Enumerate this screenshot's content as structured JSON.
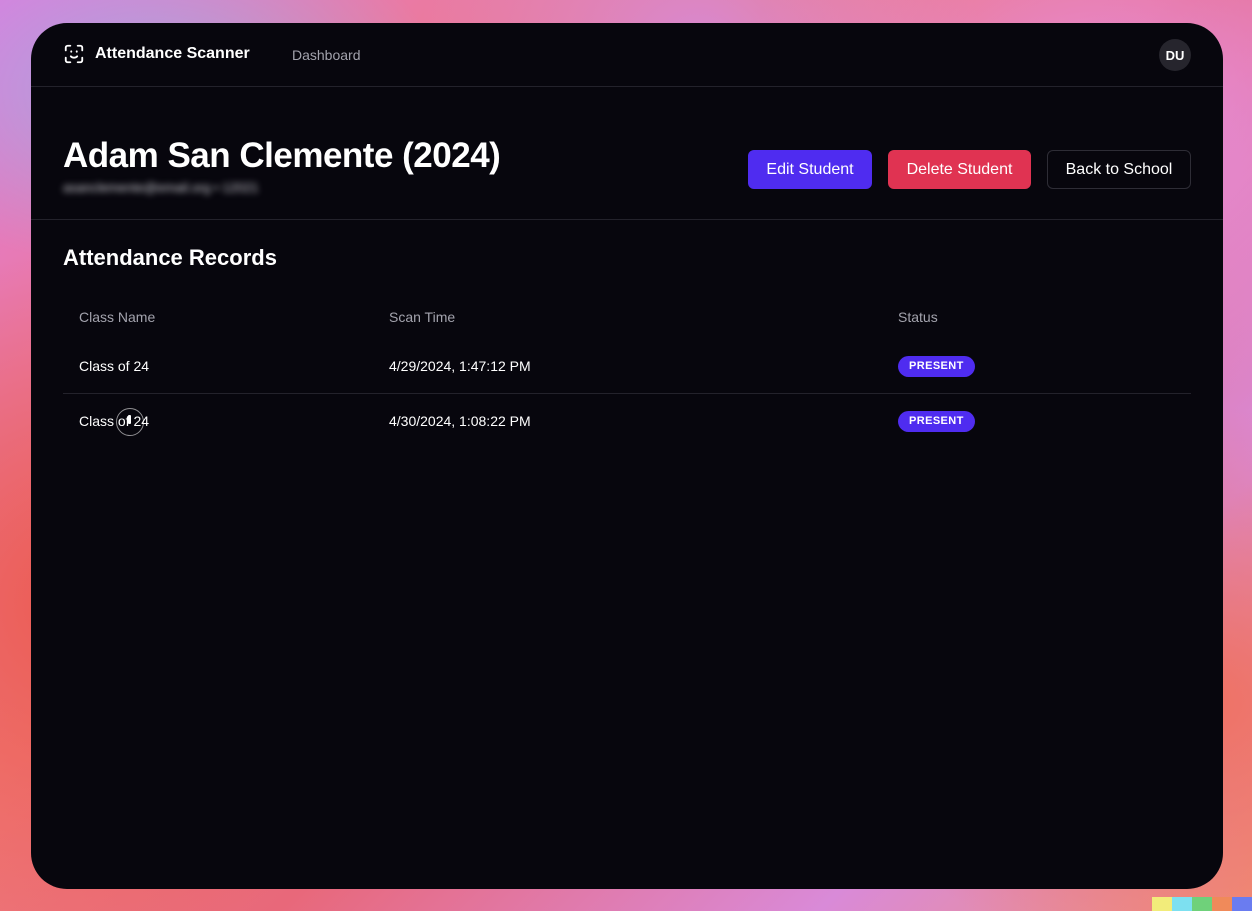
{
  "app": {
    "title": "Attendance Scanner",
    "nav_dashboard": "Dashboard",
    "avatar_initials": "DU"
  },
  "student": {
    "name": "Adam San Clemente (2024)",
    "subtitle": "asanclemente@email.org • 12021"
  },
  "actions": {
    "edit_label": "Edit Student",
    "delete_label": "Delete Student",
    "back_label": "Back to School"
  },
  "records": {
    "title": "Attendance Records",
    "columns": [
      "Class Name",
      "Scan Time",
      "Status"
    ],
    "rows": [
      {
        "class_name": "Class of 24",
        "scan_time": "4/29/2024, 1:47:12 PM",
        "status": "PRESENT"
      },
      {
        "class_name": "Class of 24",
        "scan_time": "4/30/2024, 1:08:22 PM",
        "status": "PRESENT"
      }
    ]
  },
  "colors": {
    "window_bg": "#07060d",
    "primary": "#4f2cf0",
    "danger": "#e03352",
    "muted_text": "#a3a3ad"
  },
  "icons": {
    "brand": "face-scan-icon"
  }
}
